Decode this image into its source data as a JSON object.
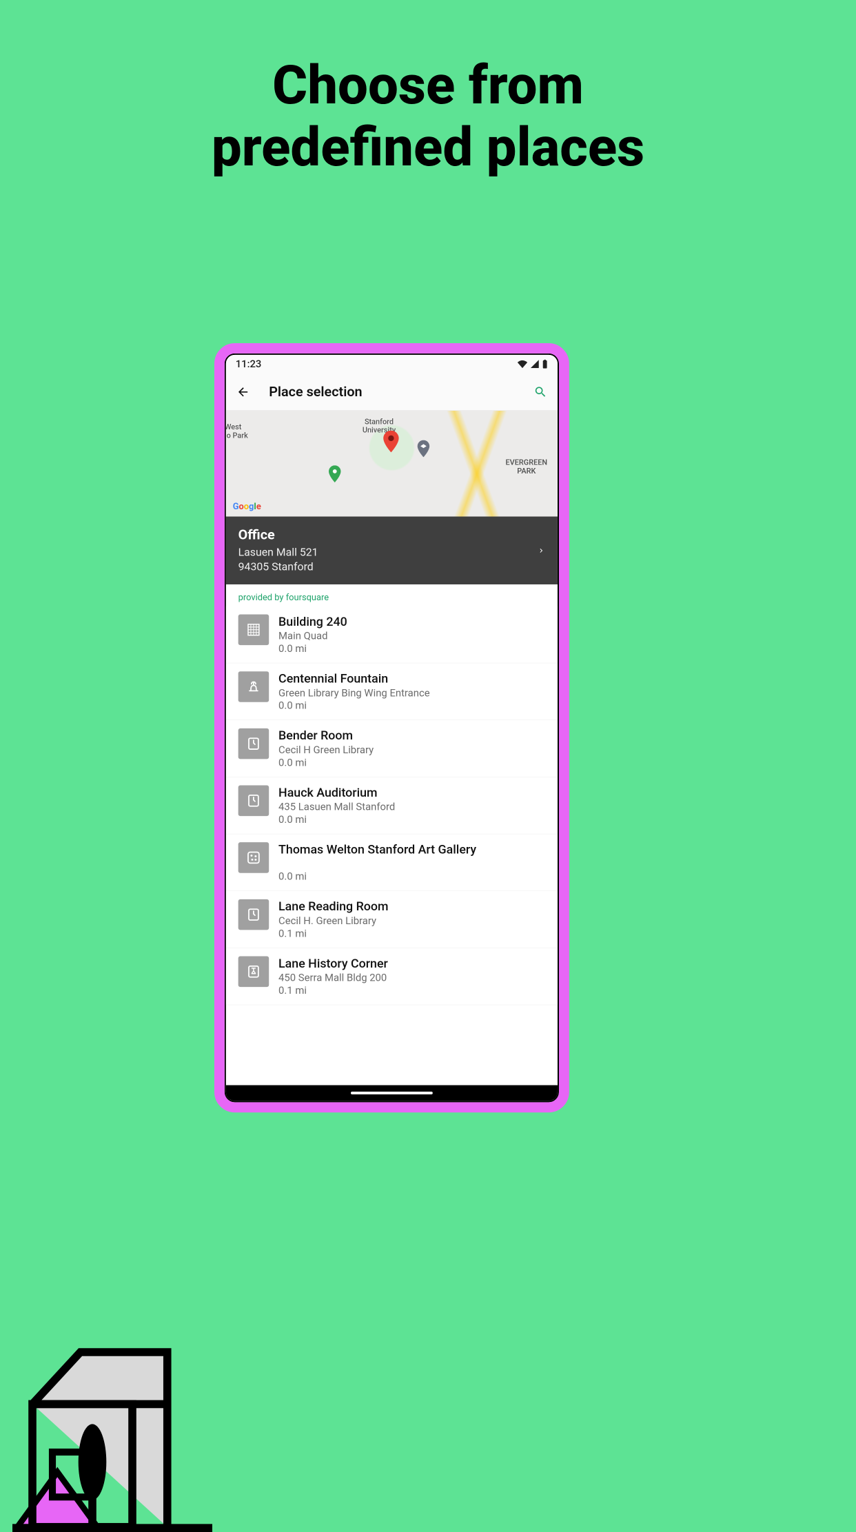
{
  "hero": {
    "line1": "Choose from",
    "line2": "predefined places"
  },
  "statusbar": {
    "time": "11:23"
  },
  "appbar": {
    "title": "Place selection"
  },
  "map": {
    "label_menlo": "West\nlo Park",
    "label_stanford": "Stanford\nUniversity",
    "label_evergreen": "EVERGREEN\nPARK"
  },
  "current": {
    "title": "Office",
    "address_line1": "Lasuen Mall 521",
    "address_line2": "94305 Stanford"
  },
  "provider": "provided by foursquare",
  "places": [
    {
      "name": "Building 240",
      "sub": "Main Quad",
      "dist": "0.0 mi",
      "icon": "building"
    },
    {
      "name": "Centennial Fountain",
      "sub": "Green Library Bing Wing Entrance",
      "dist": "0.0 mi",
      "icon": "fountain"
    },
    {
      "name": "Bender Room",
      "sub": "Cecil H Green Library",
      "dist": "0.0 mi",
      "icon": "room"
    },
    {
      "name": "Hauck Auditorium",
      "sub": "435 Lasuen Mall Stanford",
      "dist": "0.0 mi",
      "icon": "room"
    },
    {
      "name": "Thomas Welton Stanford Art Gallery",
      "sub": "",
      "dist": "0.0 mi",
      "icon": "gallery"
    },
    {
      "name": "Lane Reading Room",
      "sub": "Cecil H. Green Library",
      "dist": "0.1 mi",
      "icon": "room"
    },
    {
      "name": "Lane History Corner",
      "sub": "450 Serra Mall Bldg 200",
      "dist": "0.1 mi",
      "icon": "history"
    }
  ]
}
